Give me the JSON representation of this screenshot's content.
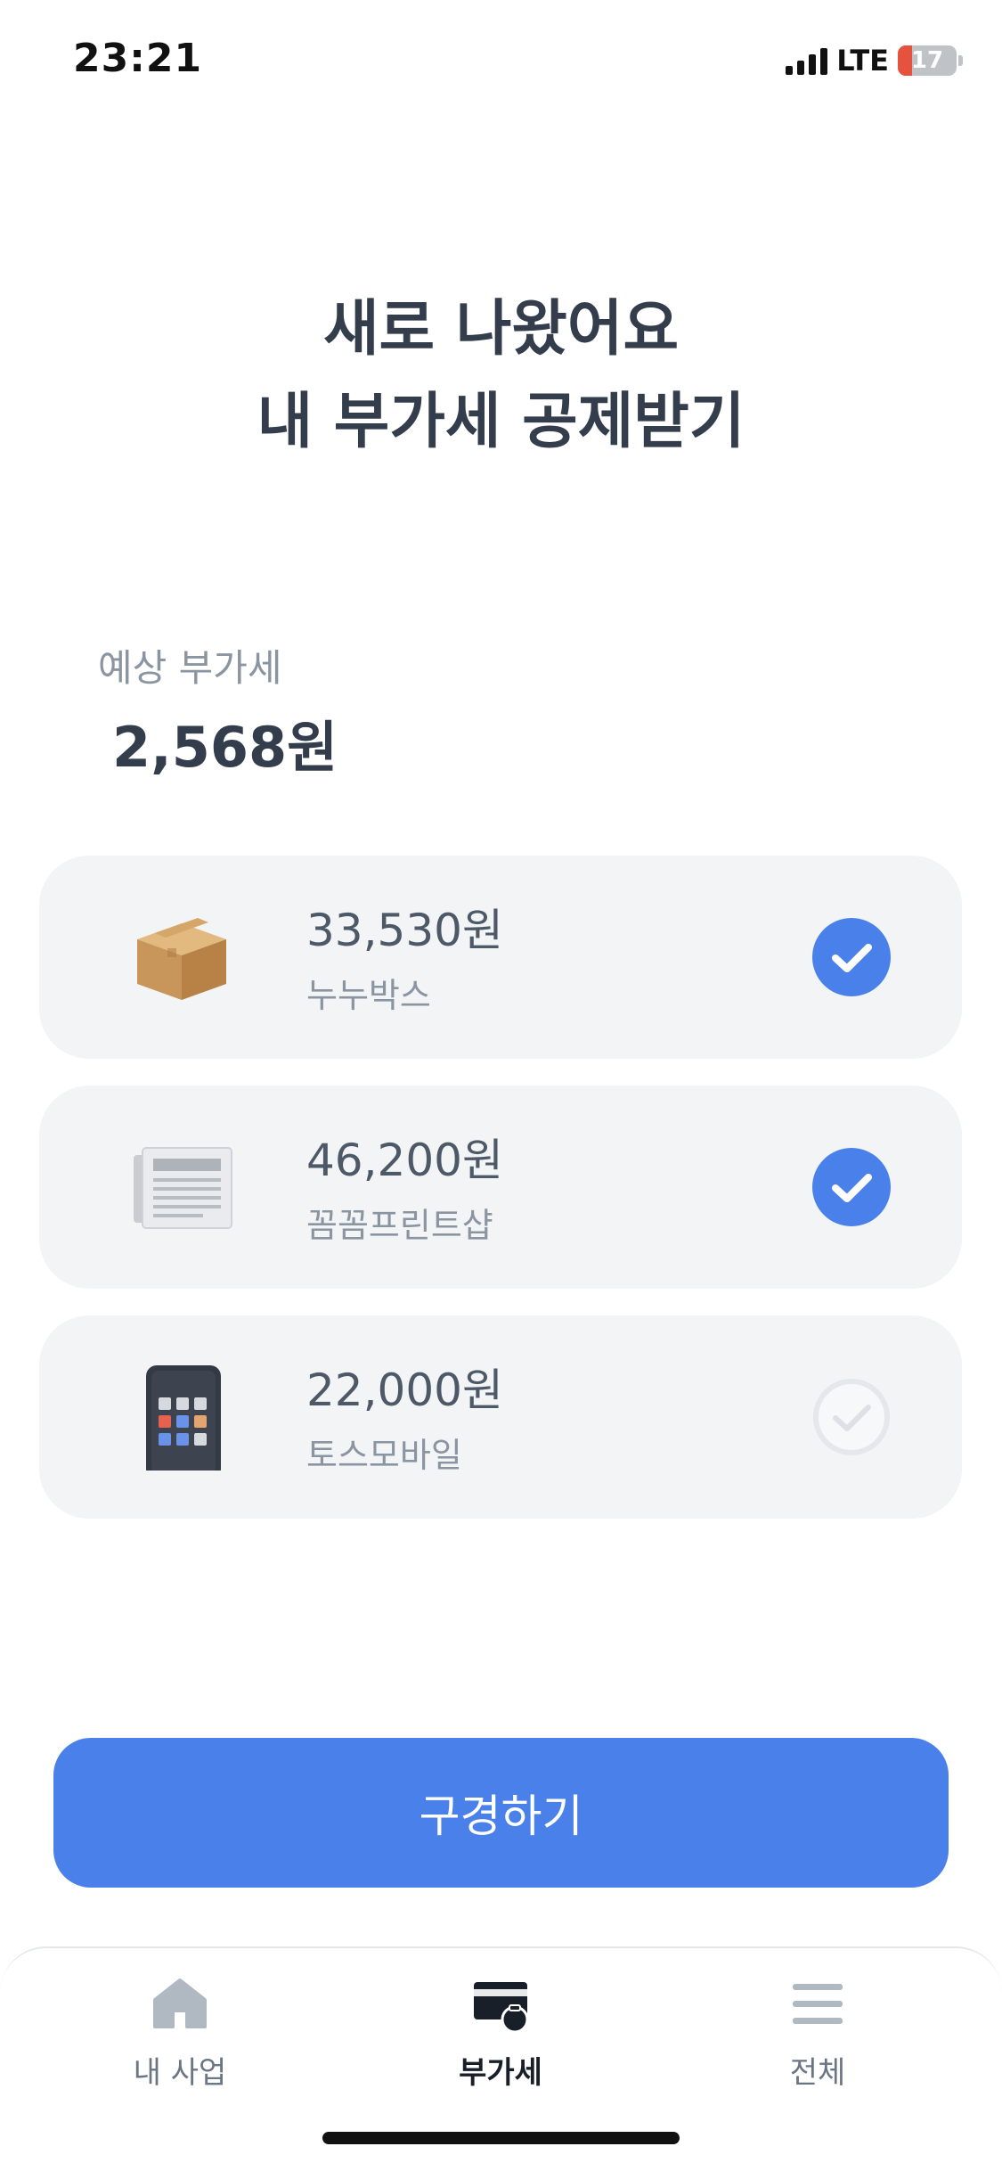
{
  "status_bar": {
    "time": "23:21",
    "network": "LTE",
    "battery": "17"
  },
  "headline": {
    "line1": "새로 나왔어요",
    "line2": "내 부가세 공제받기"
  },
  "estimate": {
    "label": "예상 부가세",
    "value": "2,568원"
  },
  "items": [
    {
      "amount": "33,530원",
      "merchant": "누누박스",
      "checked": true,
      "icon": "box-icon"
    },
    {
      "amount": "46,200원",
      "merchant": "꼼꼼프린트샵",
      "checked": true,
      "icon": "newspaper-icon"
    },
    {
      "amount": "22,000원",
      "merchant": "토스모바일",
      "checked": false,
      "icon": "phone-icon"
    }
  ],
  "cta": {
    "label": "구경하기"
  },
  "tabs": [
    {
      "label": "내 사업",
      "icon": "home-icon"
    },
    {
      "label": "부가세",
      "icon": "wallet-icon",
      "active": true
    },
    {
      "label": "전체",
      "icon": "menu-icon"
    }
  ],
  "colors": {
    "accent": "#4a80ea",
    "check_active": "#4a80ea",
    "check_inactive": "#e5e8eb"
  }
}
